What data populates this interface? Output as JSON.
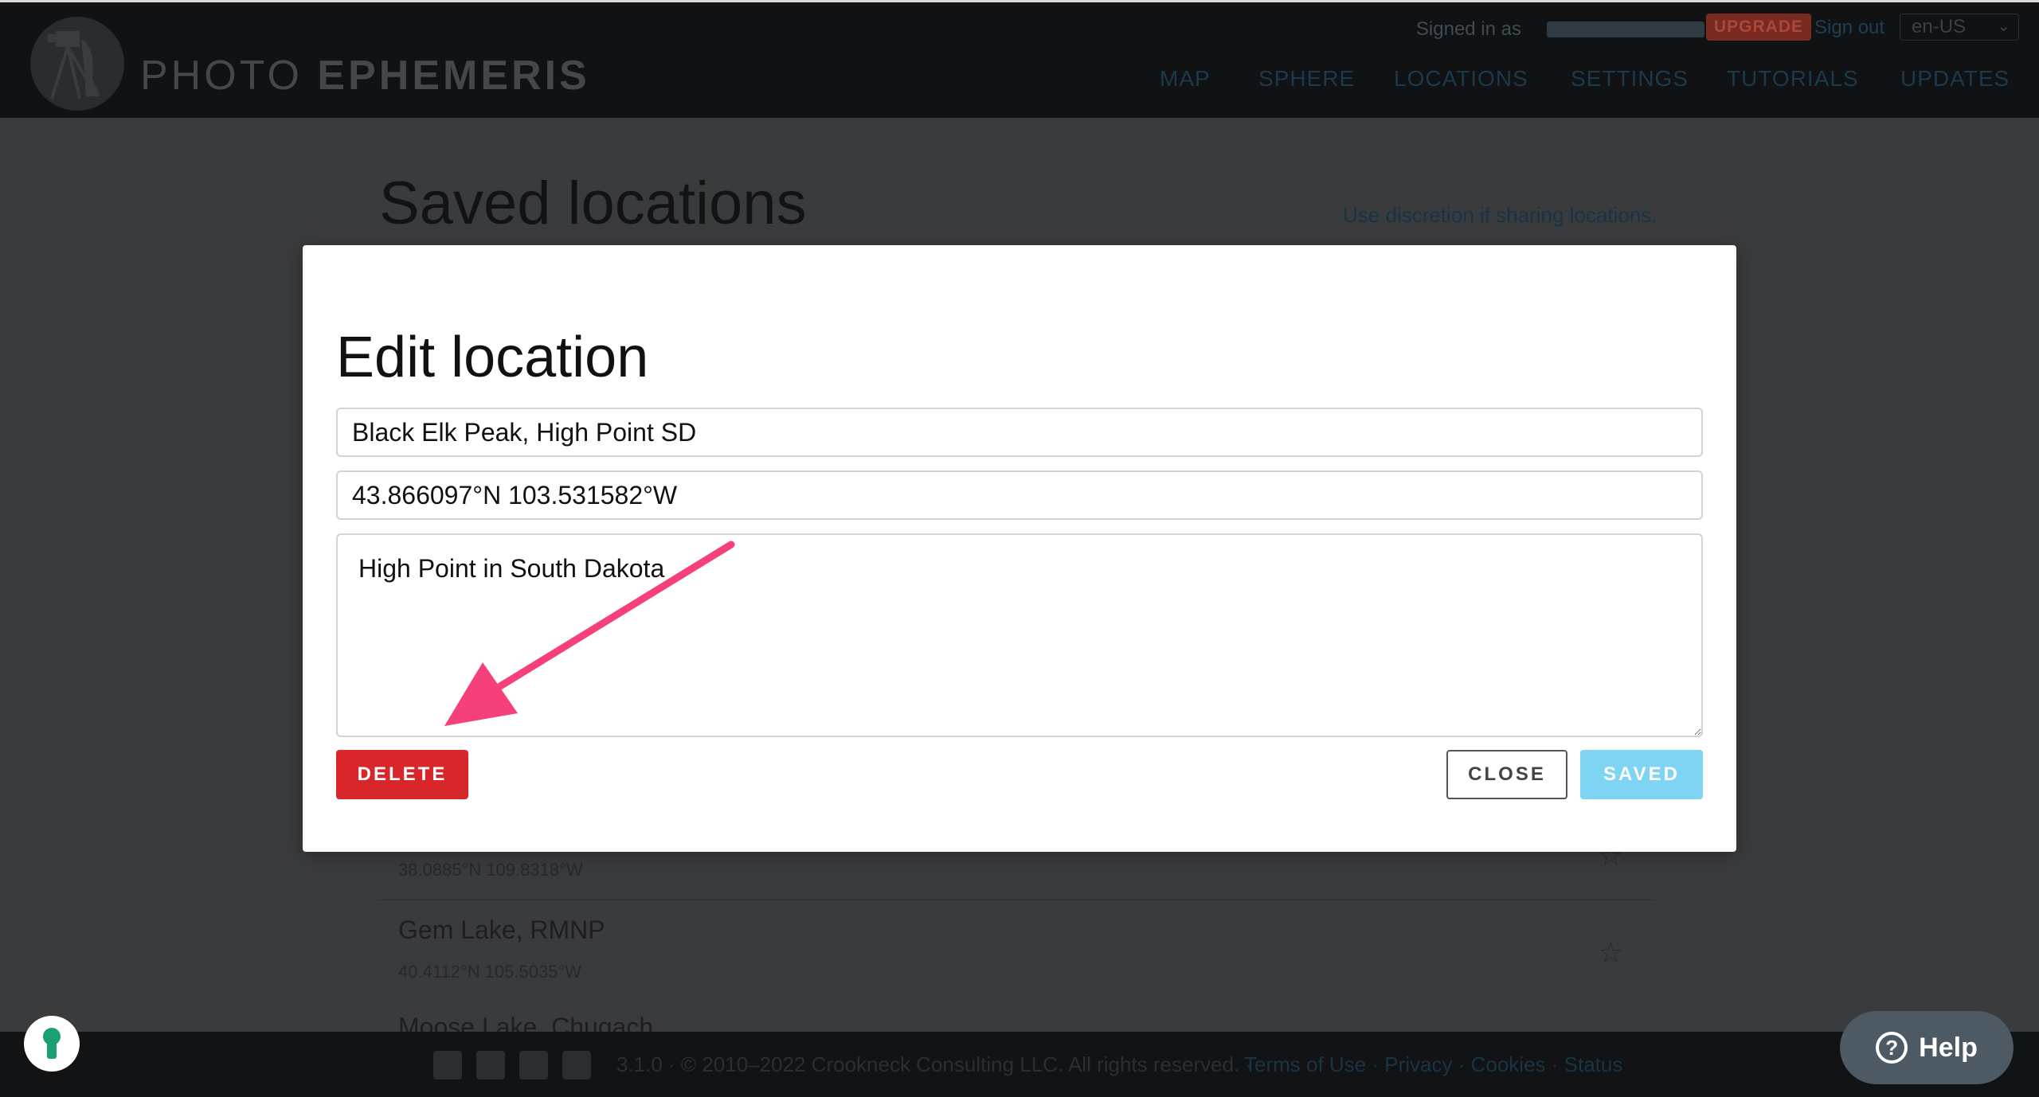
{
  "header": {
    "brand_light": "PHOTO",
    "brand_bold": "EPHEMERIS",
    "signed_in_label": "Signed in as",
    "upgrade_label": "UPGRADE",
    "sign_out_label": "Sign out",
    "language": "en-US",
    "nav": [
      "MAP",
      "SPHERE",
      "LOCATIONS",
      "SETTINGS",
      "TUTORIALS",
      "UPDATES"
    ]
  },
  "page": {
    "title": "Saved locations",
    "discretion_note": "Use discretion if sharing locations.",
    "locations": [
      {
        "name": "",
        "coords": "38.0885°N 109.8318°W"
      },
      {
        "name": "Gem Lake, RMNP",
        "coords": "40.4112°N 105.5035°W"
      },
      {
        "name": "Moose Lake, Chugach ... ",
        "coords": ""
      }
    ]
  },
  "modal": {
    "title": "Edit location",
    "name_value": "Black Elk Peak, High Point SD",
    "coords_value": "43.866097°N 103.531582°W",
    "notes_value": "High Point in South Dakota",
    "delete_label": "DELETE",
    "close_label": "CLOSE",
    "saved_label": "SAVED"
  },
  "footer": {
    "copyright": "3.1.0 · © 2010–2022 Crookneck Consulting LLC. All rights reserved. ·",
    "links": "Terms of Use · Privacy · Cookies · Status",
    "social_icons": [
      "twitter-icon",
      "facebook-icon",
      "instagram-icon",
      "vimeo-icon"
    ]
  },
  "help": {
    "label": "Help"
  },
  "colors": {
    "delete": "#d9262a",
    "saved": "#7fd3f3",
    "annotation_arrow": "#f5407a"
  }
}
